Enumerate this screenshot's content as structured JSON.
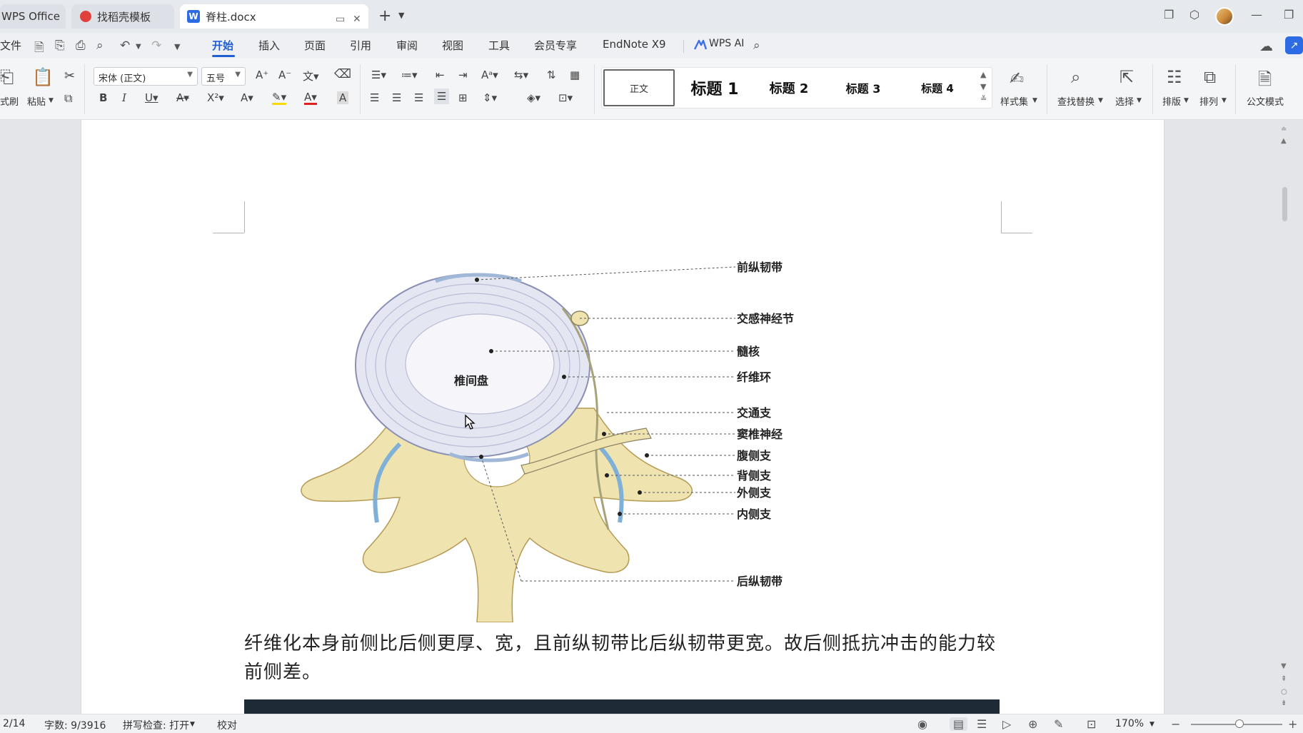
{
  "tabs": {
    "wps": "WPS Office",
    "template": "找稻壳模板",
    "doc": "脊柱.docx",
    "doc_badge": "W"
  },
  "menu": {
    "file": "文件",
    "items": [
      "开始",
      "插入",
      "页面",
      "引用",
      "审阅",
      "视图",
      "工具",
      "会员专享",
      "EndNote X9"
    ],
    "wps_ai": "WPS AI"
  },
  "ribbon": {
    "format_painter": "式刷",
    "paste": "粘贴",
    "font_name": "宋体 (正文)",
    "font_size": "五号",
    "styles": [
      "正文",
      "标题 1",
      "标题 2",
      "标题 3",
      "标题 4"
    ],
    "style_set": "样式集",
    "find_replace": "查找替换",
    "select": "选择",
    "layout": "排版",
    "arrange": "排列",
    "official_mode": "公文模式"
  },
  "figure": {
    "center_label": "椎间盘",
    "labels": [
      "前纵韧带",
      "交感神经节",
      "髓核",
      "纤维环",
      "交通支",
      "窦椎神经",
      "腹侧支",
      "背侧支",
      "外侧支",
      "内侧支",
      "后纵韧带"
    ]
  },
  "document": {
    "paragraph": "纤维化本身前侧比后侧更厚、宽，且前纵韧带比后纵韧带更宽。故后侧抵抗冲击的能力较前侧差。"
  },
  "status": {
    "page": "2/14",
    "word_count": "字数: 9/3916",
    "spell_check": "拼写检查: 打开",
    "proofread": "校对",
    "zoom": "170%"
  },
  "colors": {
    "accent": "#1f5fd1",
    "doc_badge": "#2d6be4"
  }
}
